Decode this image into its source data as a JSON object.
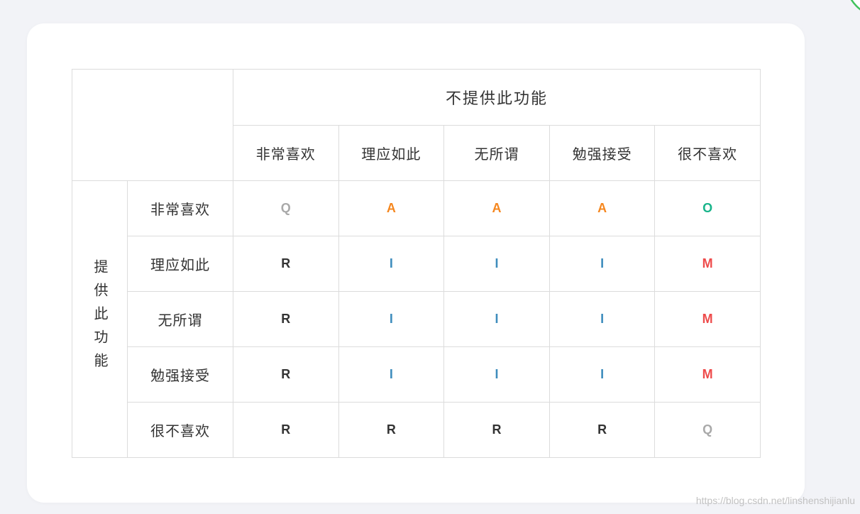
{
  "table": {
    "column_group_header": "不提供此功能",
    "row_group_header": "提供此功能",
    "columns": [
      "非常喜欢",
      "理应如此",
      "无所谓",
      "勉强接受",
      "很不喜欢"
    ],
    "rows": [
      {
        "label": "非常喜欢",
        "cells": [
          "Q",
          "A",
          "A",
          "A",
          "O"
        ]
      },
      {
        "label": "理应如此",
        "cells": [
          "R",
          "I",
          "I",
          "I",
          "M"
        ]
      },
      {
        "label": "无所谓",
        "cells": [
          "R",
          "I",
          "I",
          "I",
          "M"
        ]
      },
      {
        "label": "勉强接受",
        "cells": [
          "R",
          "I",
          "I",
          "I",
          "M"
        ]
      },
      {
        "label": "很不喜欢",
        "cells": [
          "R",
          "R",
          "R",
          "R",
          "Q"
        ]
      }
    ]
  },
  "result_colors": {
    "Q": "#a9a9a9",
    "A": "#f5871f",
    "O": "#18b48a",
    "I": "#3e8dbd",
    "M": "#ee4b4b",
    "R": "#333333"
  },
  "watermark": "https://blog.csdn.net/linshenshijianlu"
}
